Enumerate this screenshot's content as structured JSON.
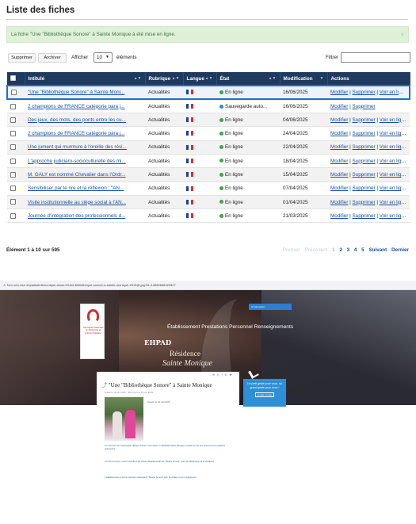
{
  "admin": {
    "title": "Liste des fiches",
    "alert": {
      "message": "La fiche \"Une \"Bibliothèque Sonore\" à Sainte Monique à été mise en ligne.",
      "close": "×"
    },
    "toolbar": {
      "delete_label": "Supprimer",
      "archive_label": "Archiver",
      "show_label": "Afficher",
      "page_size": "10",
      "elements_label": "éléments",
      "filter_label": "Filtrer",
      "filter_value": ""
    },
    "columns": [
      "Intitulé",
      "Rubrique",
      "Langue",
      "État",
      "Modification",
      "Actions"
    ],
    "rows": [
      {
        "title": "\"Une \"Bibliothèque Sonore\" à Sainte Moni...",
        "rubrique": "Actualités",
        "etat": "En ligne",
        "etat_color": "#3aa845",
        "modification": "16/06/2025",
        "actions": [
          "Modifier",
          "Supprimer",
          "Voir en ligne"
        ]
      },
      {
        "title": "2 champions de FRANCE catégorie para j...",
        "rubrique": "Actualités",
        "etat": "Sauvegarde auto...",
        "etat_color": "#2e86d6",
        "modification": "16/06/2025",
        "actions": [
          "Modifier",
          "Supprimer"
        ]
      },
      {
        "title": "Des jeux, des mots, des ponts entre les cu...",
        "rubrique": "Actualités",
        "etat": "En ligne",
        "etat_color": "#3aa845",
        "modification": "04/06/2025",
        "actions": [
          "Modifier",
          "Supprimer",
          "Voir en ligne"
        ]
      },
      {
        "title": "2 champions de FRANCE catégorie para j...",
        "rubrique": "Actualités",
        "etat": "En ligne",
        "etat_color": "#3aa845",
        "modification": "24/04/2025",
        "actions": [
          "Modifier",
          "Supprimer",
          "Voir en ligne"
        ]
      },
      {
        "title": "Une jument qui murmure à l'oreille des rési...",
        "rubrique": "Actualités",
        "etat": "En ligne",
        "etat_color": "#3aa845",
        "modification": "22/04/2025",
        "actions": [
          "Modifier",
          "Supprimer",
          "Voir en ligne"
        ]
      },
      {
        "title": "L'approche judiciaro-socioculturelle des mi...",
        "rubrique": "Actualités",
        "etat": "En ligne",
        "etat_color": "#3aa845",
        "modification": "18/04/2025",
        "actions": [
          "Modifier",
          "Supprimer",
          "Voir en ligne"
        ]
      },
      {
        "title": "M. GALY est nommé Chevalier dans l'Ordr...",
        "rubrique": "Actualités",
        "etat": "En ligne",
        "etat_color": "#3aa845",
        "modification": "15/04/2025",
        "actions": [
          "Modifier",
          "Supprimer",
          "Voir en ligne"
        ]
      },
      {
        "title": "Sensibiliser par le rire et la réflexion : \"AN...",
        "rubrique": "Actualités",
        "etat": "En ligne",
        "etat_color": "#3aa845",
        "modification": "07/04/2025",
        "actions": [
          "Modifier",
          "Supprimer",
          "Voir en ligne"
        ]
      },
      {
        "title": "Visite institutionnelle au siège social à l'AN...",
        "rubrique": "Actualités",
        "etat": "En ligne",
        "etat_color": "#3aa845",
        "modification": "01/04/2025",
        "actions": [
          "Modifier",
          "Supprimer",
          "Voir en ligne"
        ]
      },
      {
        "title": "Journée d'intégration des professionnels d...",
        "rubrique": "Actualités",
        "etat": "En ligne",
        "etat_color": "#3aa845",
        "modification": "21/03/2025",
        "actions": [
          "Modifier",
          "Supprimer",
          "Voir en ligne"
        ]
      }
    ],
    "info": "Élément 1 à 10 sur 595",
    "pager": {
      "first": "Premier",
      "prev": "Précédent",
      "pages": [
        "1",
        "2",
        "3",
        "4",
        "5"
      ],
      "next": "Suivant",
      "last": "Dernier"
    }
  },
  "browser": {
    "not_secure": "Non sécurisé",
    "url": "ehpadsaintemonique.anras.fr/Une-bibliotheque-sonore-a-sainte-monique-2513@.jpg?id=14680668323327"
  },
  "site": {
    "nav": "Établissement  Prestations  Personnel  Renseignements",
    "ehpad": "EHPAD",
    "residence": "Résidence",
    "name": "Sainte Monique",
    "logo_text": "Association Nationale de Recherche et d'Action Solidaire",
    "topbar_text": "A  Connexion",
    "breadcrumb": "Page d'accueil  >  Actualités",
    "article_title": "\"Une \"Bibliothèque Sonore\" à Sainte Monique",
    "meta": "Publié le 16 juin 2025 – Mis à jour le 16 juin 2025",
    "caption": "Créé(s)\nle 10 mai 2025",
    "card_text": "Un petit geste pour vous, un grand geste pour nous !",
    "card_button": "Je fais un don",
    "paragraphs": [
      "Le mardi 10 mai, l'association \"Bisque Sonore\" commence, en l'EHPAD Sainte Monique, à prêter la voix aux livres pour les résidents malvoyants.",
      "Lors de la remise, nous l'entendions au niveau departemental des \"Bisque Sonore\", dans la bibliothèque de la résidence.",
      "L'établissement remercie vivement l'association \"Bisque Sonore\" pour sa chaleur et son engagement."
    ]
  }
}
